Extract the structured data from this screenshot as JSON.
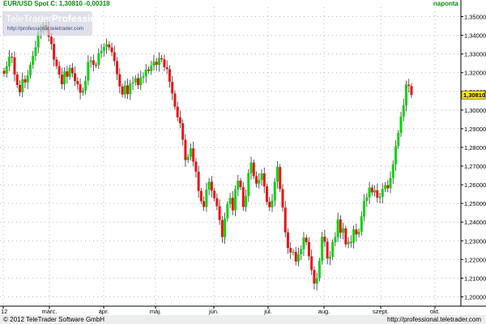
{
  "header": {
    "title": "EUR/USD Spot C: 1,30810 -0,00318",
    "timeframe": "naponta"
  },
  "watermark": {
    "brand_part1": "TeleTrader",
    "brand_part2": "Professional",
    "url": "http://professional.teletrader.com"
  },
  "footer": {
    "copyright": "© 2012 TeleTrader Software GmbH",
    "site": "http://professional.teletrader.com"
  },
  "colors": {
    "up": "#0bd40b",
    "down": "#ee1111",
    "axis": "#000000",
    "grid": "#b9b9b9",
    "text_green": "#0a8a0a",
    "price_tag": "#ffea00"
  },
  "chart_data": {
    "type": "candlestick",
    "title": "EUR/USD Spot",
    "xlabel": "",
    "ylabel": "",
    "ylim": [
      1.195,
      1.355
    ],
    "y_ticks": [
      "1,35000",
      "1,34000",
      "1,33000",
      "1,32000",
      "1,31000",
      "1,30000",
      "1,29000",
      "1,28000",
      "1,27000",
      "1,26000",
      "1,25000",
      "1,24000",
      "1,23000",
      "1,22000",
      "1,21000",
      "1,20000"
    ],
    "x_labels": [
      "12",
      "márc.",
      "ápr.",
      "máj.",
      "jún.",
      "júl.",
      "aug.",
      "szept.",
      "okt."
    ],
    "grid": true,
    "last_price": "1,30810",
    "series": [
      {
        "name": "EUR/USD",
        "close": [
          1.3195,
          1.3235,
          1.3285,
          1.3282,
          1.319,
          1.3134,
          1.3095,
          1.3165,
          1.3148,
          1.3185,
          1.3242,
          1.329,
          1.3335,
          1.3415,
          1.3425,
          1.3455,
          1.344,
          1.3392,
          1.3354,
          1.327,
          1.3235,
          1.319,
          1.3138,
          1.3207,
          1.3178,
          1.3226,
          1.3197,
          1.3155,
          1.3138,
          1.3093,
          1.3105,
          1.3157,
          1.3258,
          1.3266,
          1.3242,
          1.3241,
          1.3304,
          1.3317,
          1.3337,
          1.3352,
          1.3335,
          1.3309,
          1.3262,
          1.3192,
          1.3126,
          1.3083,
          1.3132,
          1.3085,
          1.3142,
          1.3148,
          1.317,
          1.3133,
          1.3174,
          1.3181,
          1.3217,
          1.3209,
          1.3237,
          1.3259,
          1.3242,
          1.3278,
          1.3271,
          1.3229,
          1.3219,
          1.3151,
          1.3089,
          1.3018,
          1.2961,
          1.2929,
          1.2841,
          1.2732,
          1.275,
          1.2795,
          1.2724,
          1.267,
          1.2567,
          1.2512,
          1.2481,
          1.2574,
          1.2616,
          1.2568,
          1.2528,
          1.2485,
          1.2411,
          1.232,
          1.242,
          1.2497,
          1.253,
          1.2463,
          1.2575,
          1.2622,
          1.2587,
          1.2481,
          1.2539,
          1.2663,
          1.2719,
          1.2646,
          1.2606,
          1.2626,
          1.2661,
          1.2591,
          1.2509,
          1.248,
          1.2515,
          1.2616,
          1.2695,
          1.2577,
          1.2478,
          1.2345,
          1.2262,
          1.2238,
          1.2241,
          1.2189,
          1.2228,
          1.2255,
          1.2317,
          1.2293,
          1.2217,
          1.2143,
          1.2071,
          1.2099,
          1.2193,
          1.2322,
          1.2295,
          1.2205,
          1.2214,
          1.2292,
          1.232,
          1.2415,
          1.2343,
          1.2366,
          1.2281,
          1.2294,
          1.229,
          1.2361,
          1.2334,
          1.2349,
          1.2431,
          1.2514,
          1.2533,
          1.2585,
          1.2559,
          1.2571,
          1.2531,
          1.2536,
          1.2578,
          1.2598,
          1.2581,
          1.2636,
          1.2709,
          1.2807,
          1.2877,
          1.2965,
          1.3024,
          1.3136,
          1.3129,
          1.3081
        ]
      }
    ]
  }
}
